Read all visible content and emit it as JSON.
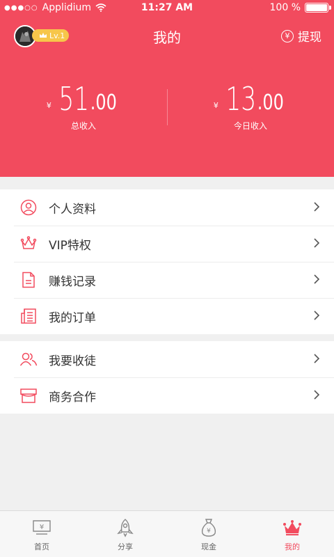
{
  "status_bar": {
    "carrier": "Applidium",
    "time": "11:27 AM",
    "battery": "100 %"
  },
  "nav": {
    "level_badge": "Lv.1",
    "title": "我的",
    "withdraw_label": "提现"
  },
  "stats": {
    "total": {
      "yen": "¥",
      "int": "51",
      "dec": ".00",
      "caption": "总收入"
    },
    "today": {
      "yen": "¥",
      "int": "13",
      "dec": ".00",
      "caption": "今日收入"
    }
  },
  "menu_group1": [
    {
      "label": "个人资料",
      "icon": "user-circle-icon"
    },
    {
      "label": "VIP特权",
      "icon": "crown-icon"
    },
    {
      "label": "赚钱记录",
      "icon": "document-icon"
    },
    {
      "label": "我的订单",
      "icon": "order-list-icon"
    }
  ],
  "menu_group2": [
    {
      "label": "我要收徒",
      "icon": "users-icon"
    },
    {
      "label": "商务合作",
      "icon": "store-icon"
    }
  ],
  "tabbar": [
    {
      "label": "首页",
      "icon": "home-yen-icon",
      "active": false
    },
    {
      "label": "分享",
      "icon": "rocket-icon",
      "active": false
    },
    {
      "label": "现金",
      "icon": "money-bag-icon",
      "active": false
    },
    {
      "label": "我的",
      "icon": "crown-icon",
      "active": true
    }
  ],
  "colors": {
    "accent": "#f24b5e",
    "level_badge": "#f7c64a"
  }
}
